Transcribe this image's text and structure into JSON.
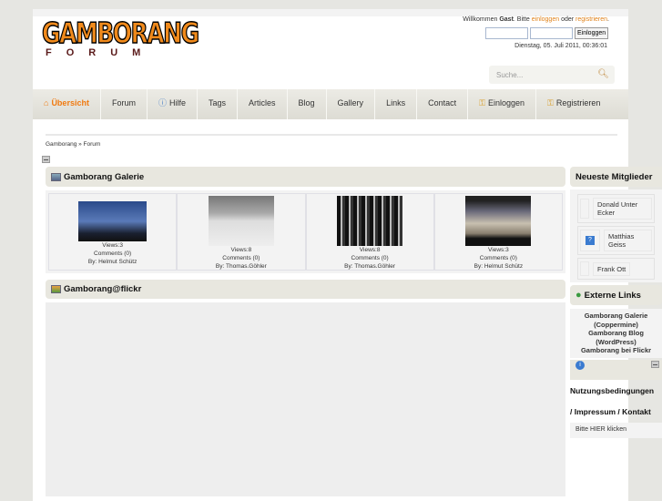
{
  "header": {
    "logo_top": "GAMBORANG",
    "logo_bottom": "FORUM",
    "welcome_prefix": "Willkommen",
    "welcome_guest": "Gast",
    "welcome_mid": ". Bitte ",
    "login_link": "einloggen",
    "welcome_or": " oder ",
    "register_link": "registrieren",
    "welcome_end": ".",
    "login_button": "Einloggen",
    "date": "Dienstag, 05. Juli 2011, 00:36:01",
    "search_placeholder": "Suche..."
  },
  "nav": [
    {
      "label": "Übersicht",
      "icon": "home-icon",
      "active": true
    },
    {
      "label": "Forum"
    },
    {
      "label": "Hilfe",
      "icon": "help-icon"
    },
    {
      "label": "Tags"
    },
    {
      "label": "Articles"
    },
    {
      "label": "Blog"
    },
    {
      "label": "Gallery"
    },
    {
      "label": "Links"
    },
    {
      "label": "Contact"
    },
    {
      "label": "Einloggen",
      "icon": "key-icon"
    },
    {
      "label": "Registrieren",
      "icon": "key-plus-icon"
    }
  ],
  "breadcrumb": "Gamborang » Forum",
  "gallery": {
    "title": "Gamborang Galerie",
    "items": [
      {
        "views": "Views:3",
        "comments": "Comments (0)",
        "by": "By: Helmut Schütz"
      },
      {
        "views": "Views:8",
        "comments": "Comments (0)",
        "by": "By: Thomas.Göhler"
      },
      {
        "views": "Views:8",
        "comments": "Comments (0)",
        "by": "By: Thomas.Göhler"
      },
      {
        "views": "Views:3",
        "comments": "Comments (0)",
        "by": "By: Helmut Schütz"
      }
    ]
  },
  "flickr": {
    "title": "Gamborang@flickr"
  },
  "sidebar": {
    "members_title": "Neueste Mitglieder",
    "members": [
      "Donald Unter Ecker",
      "Matthias Geiss",
      "Frank Ott"
    ],
    "links_title": "Externe Links",
    "links": [
      "Gamborang Galerie (Coppermine)",
      "Gamborang Blog (WordPress)",
      "Gamborang bei Flickr"
    ],
    "terms": "Nutzungsbedingungen",
    "impressum": "/ Impressum / ",
    "kontakt": "Kontakt",
    "click_here": "Bitte HIER klicken"
  }
}
